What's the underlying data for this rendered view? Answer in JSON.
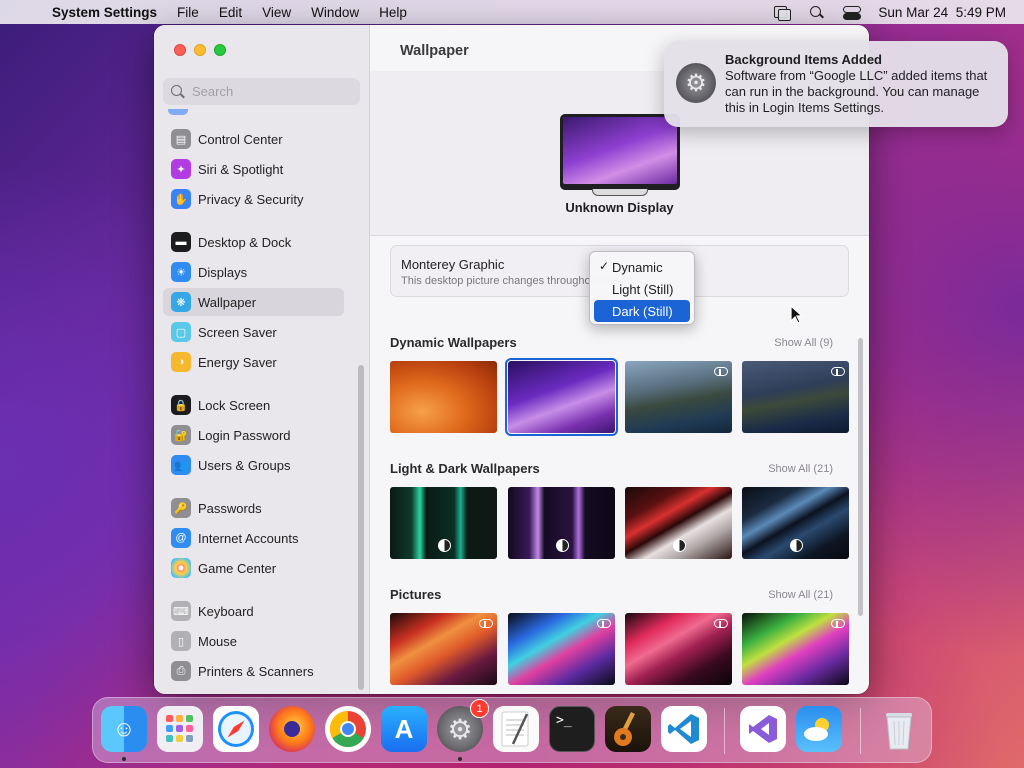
{
  "menubar": {
    "app_name": "System Settings",
    "menus": [
      "File",
      "Edit",
      "View",
      "Window",
      "Help"
    ],
    "date": "Sun Mar 24",
    "time": "5:49 PM"
  },
  "sidebar": {
    "search_placeholder": "Search",
    "items": [
      {
        "label": "Control Center",
        "color": "#8e8e93"
      },
      {
        "label": "Siri & Spotlight",
        "color": "#b23be3"
      },
      {
        "label": "Privacy & Security",
        "color": "#3b82f6"
      },
      {
        "label": "Desktop & Dock",
        "color": "#1c1c1e"
      },
      {
        "label": "Displays",
        "color": "#2f8cf0"
      },
      {
        "label": "Wallpaper",
        "color": "#35a8e8"
      },
      {
        "label": "Screen Saver",
        "color": "#5ac8e8"
      },
      {
        "label": "Energy Saver",
        "color": "#f5b82e"
      },
      {
        "label": "Lock Screen",
        "color": "#1c1c1e"
      },
      {
        "label": "Login Password",
        "color": "#8e8e93"
      },
      {
        "label": "Users & Groups",
        "color": "#2f8cf0"
      },
      {
        "label": "Passwords",
        "color": "#8e8e93"
      },
      {
        "label": "Internet Accounts",
        "color": "#2f8cf0"
      },
      {
        "label": "Game Center",
        "color": "#ffffff"
      },
      {
        "label": "Keyboard",
        "color": "#b0b0b5"
      },
      {
        "label": "Mouse",
        "color": "#b0b0b5"
      },
      {
        "label": "Printers & Scanners",
        "color": "#8e8e93"
      }
    ],
    "selected": "Wallpaper"
  },
  "main": {
    "title": "Wallpaper",
    "display_name": "Unknown Display",
    "current": {
      "name": "Monterey Graphic",
      "description": "This desktop picture changes throughout the day."
    },
    "dropdown": {
      "options": [
        "Dynamic",
        "Light (Still)",
        "Dark (Still)"
      ],
      "checked": "Dynamic",
      "highlighted": "Dark (Still)"
    },
    "sections": [
      {
        "title": "Dynamic Wallpapers",
        "show_all": "Show All (9)"
      },
      {
        "title": "Light & Dark Wallpapers",
        "show_all": "Show All (21)"
      },
      {
        "title": "Pictures",
        "show_all": "Show All (21)"
      }
    ]
  },
  "notification": {
    "title": "Background Items Added",
    "body": "Software from “Google LLC” added items that can run in the background. You can manage this in Login Items Settings."
  },
  "dock": {
    "apps": [
      "finder",
      "launchpad",
      "safari",
      "firefox",
      "chrome",
      "app-store",
      "system-settings",
      "textedit",
      "terminal",
      "garageband",
      "vscode",
      "visual-studio",
      "weather",
      "trash"
    ],
    "settings_badge": "1"
  },
  "colors": {
    "accent": "#1a64d6"
  }
}
